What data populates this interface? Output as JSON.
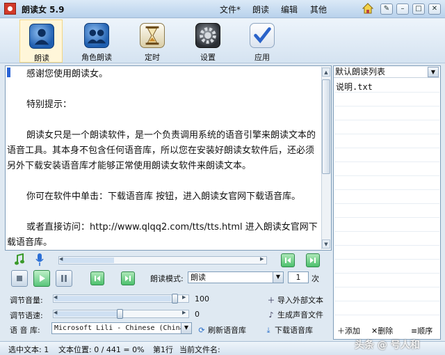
{
  "window": {
    "title": "朗读女 5.9",
    "menu": [
      "文件*",
      "朗读",
      "编辑",
      "其他"
    ]
  },
  "toolbar": {
    "read": "朗读",
    "role_read": "角色朗读",
    "timer": "定时",
    "settings": "设置",
    "apply": "应用"
  },
  "document": {
    "paragraphs": [
      "感谢您使用朗读女。",
      "特别提示：",
      "朗读女只是一个朗读软件，是一个负责调用系统的语音引擎来朗读文本的语音工具。其本身不包含任何语音库，所以您在安装好朗读女软件后，还必须另外下载安装语音库才能够正常使用朗读女软件来朗读文本。",
      "你可在软件中单击：下载语音库 按钮，进入朗读女官网下载语音库。",
      "或者直接访问：http://www.qlqq2.com/tts/tts.html  进入朗读女官网下载语音库。"
    ]
  },
  "playlist": {
    "selected_list": "默认朗读列表",
    "items": [
      "说明.txt"
    ],
    "add": "添加",
    "delete": "删除",
    "order": "顺序"
  },
  "player": {
    "mode_label": "朗读模式:",
    "mode_value": "朗读",
    "count_value": "1",
    "count_unit": "次",
    "volume_label": "调节音量:",
    "volume_value": "100",
    "volume_level": 100,
    "speed_label": "调节语速:",
    "speed_value": "0",
    "voice_label": "语 音 库:",
    "voice_value": "Microsoft Lili - Chinese (China)",
    "refresh_voices": "刷新语音库",
    "import_text": "导入外部文本",
    "generate_audio": "生成声音文件",
    "download_voices": "下载语音库"
  },
  "status": {
    "selected": "选中文本: 1",
    "position": "文本位置: 0 / 441 = 0%",
    "line": "第1行",
    "current_file": "当前文件名:"
  },
  "watermark": "头条 @ 号人和"
}
